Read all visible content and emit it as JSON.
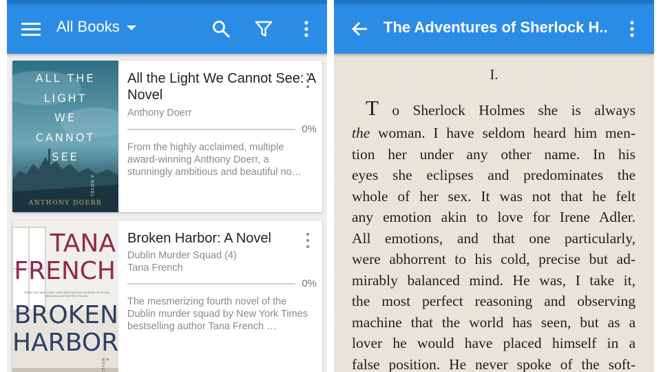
{
  "library": {
    "title": "All Books",
    "icons": {
      "menu": "hamburger-menu-icon",
      "dropdown": "caret-down-icon",
      "search": "search-icon",
      "filter": "filter-icon",
      "overflow": "more-vert-icon"
    },
    "books": [
      {
        "title": "All the Light We Cannot See: A Novel",
        "series": "",
        "author": "Anthony Doerr",
        "progress": 0,
        "progress_label": "0%",
        "description": "From the highly acclaimed, multiple award-winning Anthony Doerr, a stunningly ambitious and beautiful no…",
        "cover": {
          "title_words": [
            "ALL THE",
            "LIGHT",
            "WE",
            "CANNOT",
            "SEE"
          ],
          "side_text": "A NOVEL",
          "author": "ANTHONY DOERR"
        }
      },
      {
        "title": "Broken Harbor: A Novel",
        "series": "Dublin Murder Squad (4)",
        "author": "Tana French",
        "progress": 0,
        "progress_label": "0%",
        "description": "The mesmerizing fourth novel of the Dublin murder squad by New York Times bestselling author Tana French …",
        "cover": {
          "author_line1": "TANA",
          "author_line2": "FRENCH",
          "tagline": "FROM THE NEW YORK TIMES BESTSELLING AUTHOR OF IN THE WOODS and A FAITHFUL PLACE",
          "title_line1": "BROKEN",
          "title_line2": "HARBOR",
          "side_text": "A NOVEL"
        }
      }
    ]
  },
  "reader": {
    "title": "The Adventures of Sherlock H..",
    "icons": {
      "back": "arrow-back-icon",
      "overflow": "more-vert-icon"
    },
    "chapter": "I.",
    "dropcap": "T",
    "lines": [
      "o Sherlock Holmes she is always",
      "woman. I have seldom heard him men-",
      "tion her under any other name. In his",
      "eyes she eclipses and predominates the",
      "whole of her sex. It was not that he felt",
      "any emotion akin to love for Irene Adler.",
      "All emotions, and that one particularly,",
      "were abhorrent to his cold, precise but ad-",
      "mirably balanced mind. He was, I take it,",
      "the most perfect reasoning and observing",
      "machine that the world has seen, but as a",
      "lover he would have placed himself in a",
      "false position. He never spoke of the soft-"
    ],
    "italic_word": "the"
  },
  "colors": {
    "appbar": "#2b8ce6",
    "paper": "#ebe6db",
    "text_secondary": "#8a8a8a"
  }
}
